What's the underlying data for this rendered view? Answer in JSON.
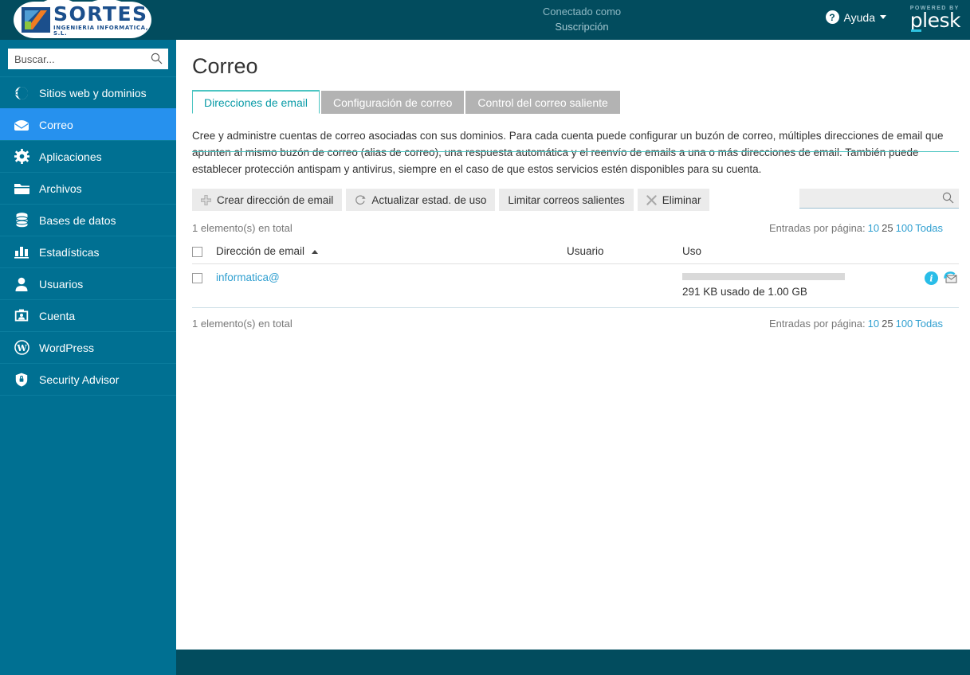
{
  "header": {
    "logo": {
      "name": "SORTES",
      "subtitle": "INGENIERIA INFORMATICA, S.L."
    },
    "connected_label": "Conectado como",
    "connected_value": "Suscripción",
    "help_label": "Ayuda",
    "plesk_powered": "POWERED BY",
    "plesk_name": "plesk"
  },
  "sidebar": {
    "search_placeholder": "Buscar...",
    "search_value": "",
    "items": [
      {
        "label": "Sitios web y dominios",
        "icon": "globe-icon",
        "active": false
      },
      {
        "label": "Correo",
        "icon": "envelope-icon",
        "active": true
      },
      {
        "label": "Aplicaciones",
        "icon": "gear-icon",
        "active": false
      },
      {
        "label": "Archivos",
        "icon": "folder-icon",
        "active": false
      },
      {
        "label": "Bases de datos",
        "icon": "database-icon",
        "active": false
      },
      {
        "label": "Estadísticas",
        "icon": "bar-chart-icon",
        "active": false
      },
      {
        "label": "Usuarios",
        "icon": "user-icon",
        "active": false
      },
      {
        "label": "Cuenta",
        "icon": "account-card-icon",
        "active": false
      },
      {
        "label": "WordPress",
        "icon": "wordpress-icon",
        "active": false
      },
      {
        "label": "Security Advisor",
        "icon": "shield-icon",
        "active": false
      }
    ]
  },
  "main": {
    "page_title": "Correo",
    "tabs": [
      {
        "label": "Direcciones de email",
        "active": true
      },
      {
        "label": "Configuración de correo",
        "active": false
      },
      {
        "label": "Control del correo saliente",
        "active": false
      }
    ],
    "description": "Cree y administre cuentas de correo asociadas con sus dominios. Para cada cuenta puede configurar un buzón de correo, múltiples direcciones de email que apunten al mismo buzón de correo (alias de correo), una respuesta automática y el reenvío de emails a una o más direcciones de email. También puede establecer protección antispam y antivirus, siempre en el caso de que estos servicios estén disponibles para su cuenta.",
    "toolbar": [
      {
        "label": "Crear dirección de email",
        "icon": "plus-icon"
      },
      {
        "label": "Actualizar estad. de uso",
        "icon": "refresh-icon"
      },
      {
        "label": "Limitar correos salientes",
        "icon": "none"
      },
      {
        "label": "Eliminar",
        "icon": "remove-x-icon"
      }
    ],
    "table_search": {
      "placeholder": "",
      "value": ""
    },
    "total_label": "1 elemento(s) en total",
    "pager": {
      "label": "Entradas por página:",
      "options": [
        "10",
        "25",
        "100",
        "Todas"
      ],
      "current": "25"
    },
    "table": {
      "columns": [
        "Dirección de email",
        "Usuario",
        "Uso"
      ],
      "sort_column": "Dirección de email",
      "sort_direction": "asc",
      "rows": [
        {
          "address": "informatica@",
          "user": "",
          "usage_text": "291 KB usado de 1.00 GB",
          "usage_used": "291 KB",
          "usage_total": "1.00 GB",
          "usage_percent": 0.0284,
          "actions": [
            "info-icon",
            "webmail-icon"
          ]
        }
      ]
    }
  },
  "colors": {
    "header_bg": "#024c5e",
    "sidebar_bg": "#007092",
    "sidebar_active": "#2691ee",
    "tab_accent": "#4cc5c2",
    "link": "#2f9fd0",
    "info_icon": "#29bde8"
  }
}
